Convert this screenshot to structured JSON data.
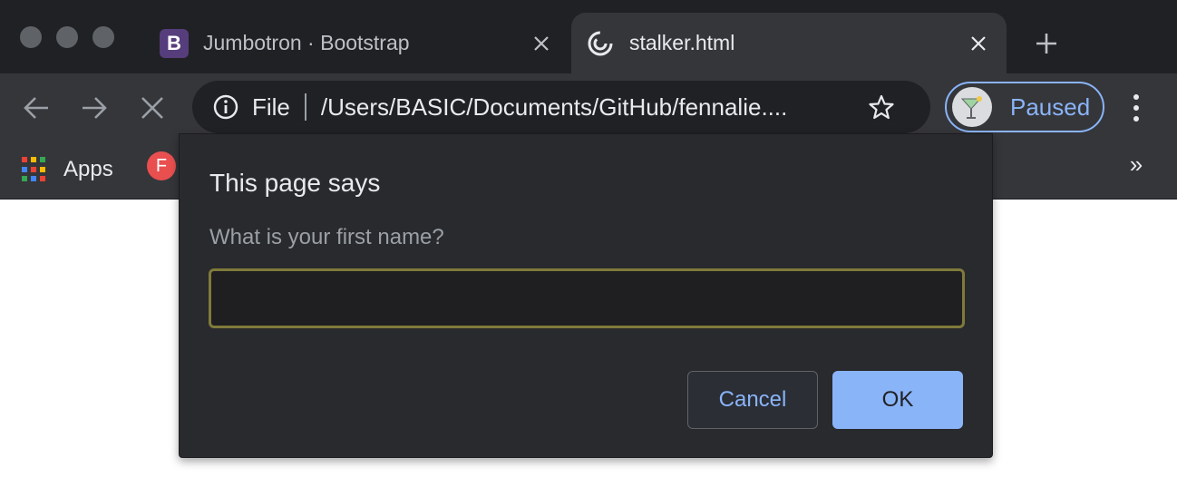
{
  "tabs": [
    {
      "title": "Jumbotron · Bootstrap",
      "favicon": "bootstrap-icon",
      "favicon_text": "B",
      "active": false
    },
    {
      "title": "stalker.html",
      "favicon": "loading-spinner-icon",
      "active": true
    }
  ],
  "omnibox": {
    "scheme_chip": "File",
    "url": "/Users/BASIC/Documents/GitHub/fennalie...."
  },
  "profile": {
    "label": "Paused"
  },
  "bookmarks": {
    "apps_label": "Apps",
    "f_bookmark_letter": "F",
    "overflow": "»"
  },
  "dialog": {
    "title": "This page says",
    "message": "What is your first name?",
    "input_value": "",
    "cancel_label": "Cancel",
    "ok_label": "OK"
  },
  "colors": {
    "accent": "#8ab4f8",
    "frame": "#202124",
    "toolbar": "#35363a",
    "dialog_bg": "#292a2d",
    "input_border": "#7f7a3a"
  }
}
